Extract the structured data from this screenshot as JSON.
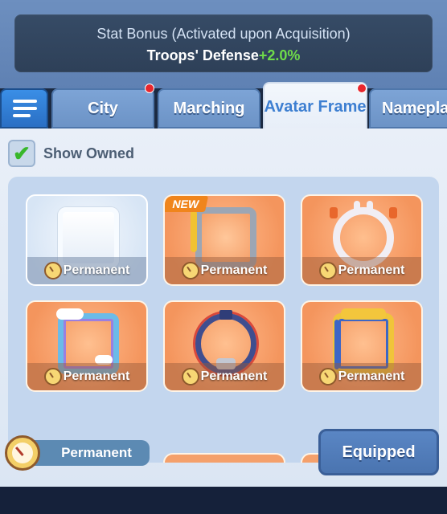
{
  "stat_bonus": {
    "title": "Stat Bonus (Activated upon Acquisition)",
    "label": "Troops' Defense",
    "value": "+2.0%"
  },
  "tabs": [
    {
      "label": "City",
      "active": false,
      "notification": true
    },
    {
      "label": "Marching",
      "active": false,
      "notification": false
    },
    {
      "label": "Avatar Frame",
      "active": true,
      "notification": true
    },
    {
      "label": "Nameplate",
      "active": false,
      "notification": false
    }
  ],
  "filter": {
    "show_owned_label": "Show Owned",
    "checked": true
  },
  "frames": [
    {
      "name": "blank-frame",
      "duration": "Permanent",
      "new": false
    },
    {
      "name": "golden-pipe-frame",
      "duration": "Permanent",
      "new": true,
      "badge": "NEW"
    },
    {
      "name": "bunny-frame",
      "duration": "Permanent",
      "new": false
    },
    {
      "name": "rainbow-cloud-frame",
      "duration": "Permanent",
      "new": false
    },
    {
      "name": "wreath-frame",
      "duration": "Permanent",
      "new": false
    },
    {
      "name": "golden-ribbon-frame",
      "duration": "Permanent",
      "new": false
    }
  ],
  "selected": {
    "duration": "Permanent",
    "button_label": "Equipped"
  },
  "colors": {
    "accent": "#3d7fd1",
    "positive": "#6fdc4a",
    "notification": "#e8262d",
    "card_orange": "#f4955d"
  }
}
